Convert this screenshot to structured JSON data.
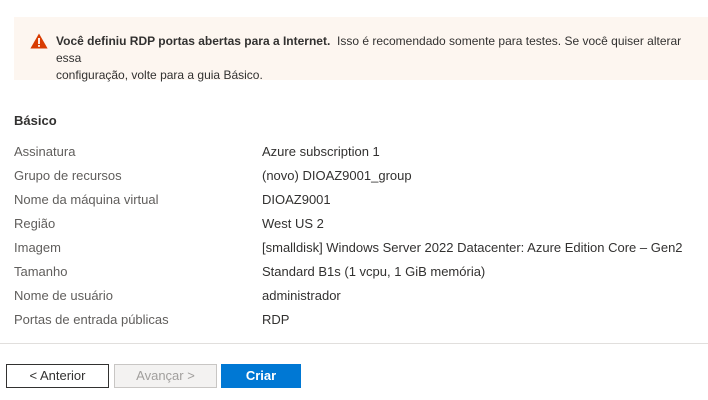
{
  "warning": {
    "icon": "warning-triangle-icon",
    "color": "#d83b01",
    "bold_text": "Você definiu RDP portas abertas para a Internet.",
    "text_line1": "Isso é recomendado somente para testes.  Se você quiser alterar essa",
    "text_line2": "configuração, volte para a guia Básico."
  },
  "summary": {
    "section_title": "Básico",
    "rows": [
      {
        "label": "Assinatura",
        "value": "Azure subscription 1"
      },
      {
        "label": "Grupo de recursos",
        "value": "(novo) DIOAZ9001_group"
      },
      {
        "label": "Nome da máquina virtual",
        "value": "DIOAZ9001"
      },
      {
        "label": "Região",
        "value": "West US 2"
      },
      {
        "label": "Imagem",
        "value": "[smalldisk] Windows Server 2022 Datacenter: Azure Edition Core – Gen2"
      },
      {
        "label": "Tamanho",
        "value": "Standard B1s (1 vcpu, 1 GiB memória)"
      },
      {
        "label": "Nome de usuário",
        "value": "administrador"
      },
      {
        "label": "Portas de entrada públicas",
        "value": "RDP"
      }
    ]
  },
  "footer": {
    "prev_label": "< Anterior",
    "next_label": "Avançar >",
    "create_label": "Criar",
    "accent_color": "#0078d4"
  }
}
